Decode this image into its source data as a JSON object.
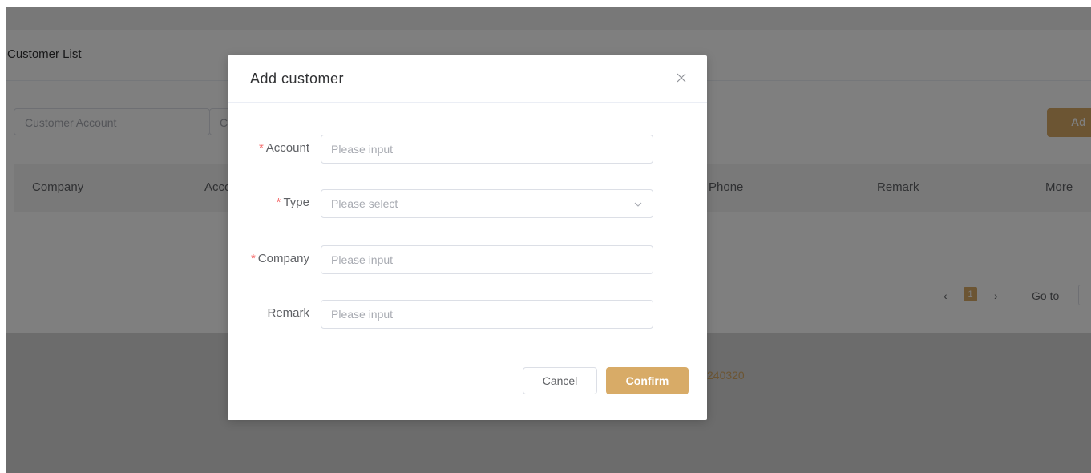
{
  "page": {
    "title": "Customer List",
    "search_placeholder": "Customer Account",
    "search2_placeholder": "C",
    "add_button_label": "Ad",
    "table_headers": [
      "Company",
      "Acco",
      "Phone",
      "Remark",
      "More"
    ],
    "pagination": {
      "prev": "‹",
      "current": "1",
      "next": "›",
      "goto_label": "Go to"
    },
    "footer_text": "240320"
  },
  "dialog": {
    "title": "Add customer",
    "fields": [
      {
        "label": "Account",
        "required": true,
        "placeholder": "Please input",
        "type": "input"
      },
      {
        "label": "Type",
        "required": true,
        "placeholder": "Please select",
        "type": "select"
      },
      {
        "label": "Company",
        "required": true,
        "placeholder": "Please input",
        "type": "input"
      },
      {
        "label": "Remark",
        "required": false,
        "placeholder": "Please input",
        "type": "input"
      }
    ],
    "cancel_label": "Cancel",
    "confirm_label": "Confirm"
  },
  "colors": {
    "accent": "#d8ab67",
    "required": "#f56c6c",
    "overlay": "rgba(0,0,0,0.5)"
  },
  "icons": {
    "close": "close-icon",
    "select_arrow": "chevron-down-icon",
    "prev": "chevron-left-icon",
    "next": "chevron-right-icon"
  }
}
